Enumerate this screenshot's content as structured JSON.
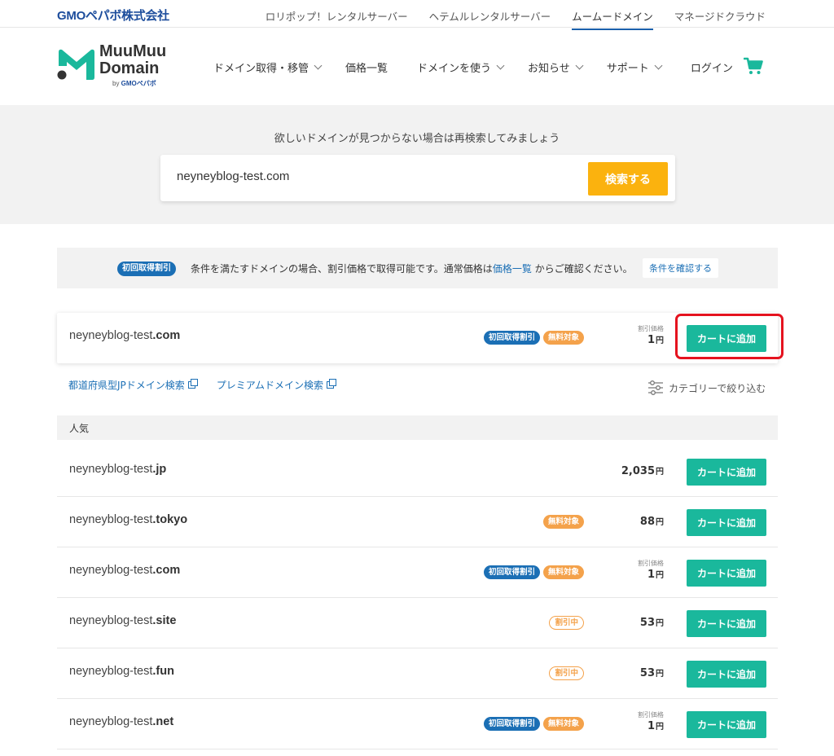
{
  "topbar": {
    "company_logo": "GMOペパボ株式会社",
    "sister_links": [
      {
        "label": "ロリポップ！レンタルサーバー",
        "active": false
      },
      {
        "label": "ヘテムルレンタルサーバー",
        "active": false
      },
      {
        "label": "ムームードメイン",
        "active": true
      },
      {
        "label": "マネージドクラウド",
        "active": false
      }
    ]
  },
  "brand": {
    "line1": "MuuMuu",
    "line2": "Domain",
    "by_prefix": "by ",
    "by_company": "GMOペパボ",
    "colors": {
      "teal": "#1ab89c",
      "dark": "#333333"
    }
  },
  "nav": [
    {
      "label": "ドメイン取得・移管",
      "has_dropdown": true
    },
    {
      "label": "価格一覧",
      "has_dropdown": false
    },
    {
      "label": "ドメインを使う",
      "has_dropdown": true
    },
    {
      "label": "お知らせ",
      "has_dropdown": true
    },
    {
      "label": "サポート",
      "has_dropdown": true
    },
    {
      "label": "ログイン",
      "has_dropdown": false
    }
  ],
  "search": {
    "hint": "欲しいドメインが見つからない場合は再検索してみましょう",
    "value": "neyneyblog-test.com",
    "button": "検索する"
  },
  "notice": {
    "badge": "初回取得割引",
    "text_before": "条件を満たすドメインの場合、割引価格で取得可能です。通常価格は",
    "link": "価格一覧",
    "text_after": "からご確認ください。",
    "button": "条件を確認する"
  },
  "featured": {
    "name": "neyneyblog-test",
    "tld": ".com",
    "badges": [
      {
        "label": "初回取得割引",
        "style": "blue"
      },
      {
        "label": "無料対象",
        "style": "orange"
      }
    ],
    "price_label": "割引価格",
    "price": "1",
    "yen": "円",
    "button": "カートに追加"
  },
  "links": {
    "jp_search": "都道府県型JPドメイン検索",
    "premium_search": "プレミアムドメイン検索",
    "filter": "カテゴリーで絞り込む"
  },
  "section": {
    "title": "人気"
  },
  "results": [
    {
      "name": "neyneyblog-test",
      "tld": ".jp",
      "badges": [],
      "price_label": "",
      "price": "2,035",
      "yen": "円",
      "button": "カートに追加"
    },
    {
      "name": "neyneyblog-test",
      "tld": ".tokyo",
      "badges": [
        {
          "label": "無料対象",
          "style": "orange"
        }
      ],
      "price_label": "",
      "price": "88",
      "yen": "円",
      "button": "カートに追加"
    },
    {
      "name": "neyneyblog-test",
      "tld": ".com",
      "badges": [
        {
          "label": "初回取得割引",
          "style": "blue"
        },
        {
          "label": "無料対象",
          "style": "orange"
        }
      ],
      "price_label": "割引価格",
      "price": "1",
      "yen": "円",
      "button": "カートに追加"
    },
    {
      "name": "neyneyblog-test",
      "tld": ".site",
      "badges": [
        {
          "label": "割引中",
          "style": "outline"
        }
      ],
      "price_label": "",
      "price": "53",
      "yen": "円",
      "button": "カートに追加"
    },
    {
      "name": "neyneyblog-test",
      "tld": ".fun",
      "badges": [
        {
          "label": "割引中",
          "style": "outline"
        }
      ],
      "price_label": "",
      "price": "53",
      "yen": "円",
      "button": "カートに追加"
    },
    {
      "name": "neyneyblog-test",
      "tld": ".net",
      "badges": [
        {
          "label": "初回取得割引",
          "style": "blue"
        },
        {
          "label": "無料対象",
          "style": "orange"
        }
      ],
      "price_label": "割引価格",
      "price": "1",
      "yen": "円",
      "button": "カートに追加"
    }
  ],
  "icons": {
    "cart": "cart-icon",
    "external": "external-link-icon",
    "filter": "sliders-icon",
    "chevron": "chevron-down-icon"
  }
}
